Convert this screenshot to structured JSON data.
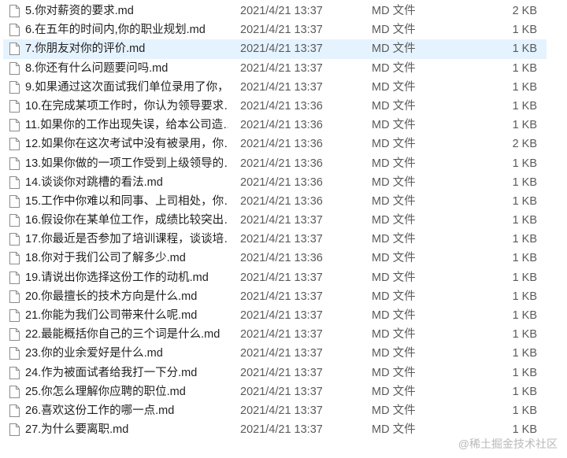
{
  "files": [
    {
      "name": "5.你对薪资的要求.md",
      "date": "2021/4/21 13:37",
      "type": "MD 文件",
      "size": "2 KB"
    },
    {
      "name": "6.在五年的时间内,你的职业规划.md",
      "date": "2021/4/21 13:37",
      "type": "MD 文件",
      "size": "1 KB"
    },
    {
      "name": "7.你朋友对你的评价.md",
      "date": "2021/4/21 13:37",
      "type": "MD 文件",
      "size": "1 KB"
    },
    {
      "name": "8.你还有什么问题要问吗.md",
      "date": "2021/4/21 13:37",
      "type": "MD 文件",
      "size": "1 KB"
    },
    {
      "name": "9.如果通过这次面试我们单位录用了你，…",
      "date": "2021/4/21 13:37",
      "type": "MD 文件",
      "size": "1 KB"
    },
    {
      "name": "10.在完成某项工作时，你认为领导要求…",
      "date": "2021/4/21 13:36",
      "type": "MD 文件",
      "size": "1 KB"
    },
    {
      "name": "11.如果你的工作出现失误，给本公司造…",
      "date": "2021/4/21 13:36",
      "type": "MD 文件",
      "size": "1 KB"
    },
    {
      "name": "12.如果你在这次考试中没有被录用，你…",
      "date": "2021/4/21 13:36",
      "type": "MD 文件",
      "size": "2 KB"
    },
    {
      "name": "13.如果你做的一项工作受到上级领导的…",
      "date": "2021/4/21 13:36",
      "type": "MD 文件",
      "size": "1 KB"
    },
    {
      "name": "14.谈谈你对跳槽的看法.md",
      "date": "2021/4/21 13:36",
      "type": "MD 文件",
      "size": "1 KB"
    },
    {
      "name": "15.工作中你难以和同事、上司相处，你…",
      "date": "2021/4/21 13:36",
      "type": "MD 文件",
      "size": "1 KB"
    },
    {
      "name": "16.假设你在某单位工作，成绩比较突出…",
      "date": "2021/4/21 13:37",
      "type": "MD 文件",
      "size": "1 KB"
    },
    {
      "name": "17.你最近是否参加了培训课程，谈谈培…",
      "date": "2021/4/21 13:37",
      "type": "MD 文件",
      "size": "1 KB"
    },
    {
      "name": "18.你对于我们公司了解多少.md",
      "date": "2021/4/21 13:36",
      "type": "MD 文件",
      "size": "1 KB"
    },
    {
      "name": "19.请说出你选择这份工作的动机.md",
      "date": "2021/4/21 13:37",
      "type": "MD 文件",
      "size": "1 KB"
    },
    {
      "name": "20.你最擅长的技术方向是什么.md",
      "date": "2021/4/21 13:37",
      "type": "MD 文件",
      "size": "1 KB"
    },
    {
      "name": "21.你能为我们公司带来什么呢.md",
      "date": "2021/4/21 13:37",
      "type": "MD 文件",
      "size": "1 KB"
    },
    {
      "name": "22.最能概括你自己的三个词是什么.md",
      "date": "2021/4/21 13:37",
      "type": "MD 文件",
      "size": "1 KB"
    },
    {
      "name": "23.你的业余爱好是什么.md",
      "date": "2021/4/21 13:37",
      "type": "MD 文件",
      "size": "1 KB"
    },
    {
      "name": "24.作为被面试者给我打一下分.md",
      "date": "2021/4/21 13:37",
      "type": "MD 文件",
      "size": "1 KB"
    },
    {
      "name": "25.你怎么理解你应聘的职位.md",
      "date": "2021/4/21 13:37",
      "type": "MD 文件",
      "size": "1 KB"
    },
    {
      "name": "26.喜欢这份工作的哪一点.md",
      "date": "2021/4/21 13:37",
      "type": "MD 文件",
      "size": "1 KB"
    },
    {
      "name": "27.为什么要离职.md",
      "date": "2021/4/21 13:37",
      "type": "MD 文件",
      "size": "1 KB"
    }
  ],
  "hover_row_index": 2,
  "watermark": "@稀土掘金技术社区",
  "colors": {
    "hover": "#e5f3ff",
    "text": "#1f1f1f",
    "secondary_text": "#5a5a5a"
  }
}
